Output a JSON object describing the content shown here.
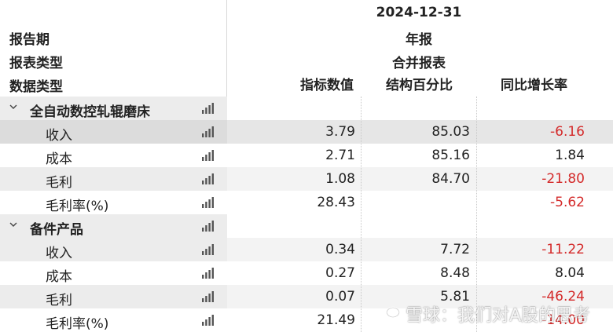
{
  "header": {
    "row_labels": [
      "报告期",
      "报表类型",
      "数据类型"
    ],
    "period": "2024-12-31",
    "period_kind": "年报",
    "statement_type": "合并报表",
    "columns": [
      "指标数值",
      "结构百分比",
      "同比增长率"
    ]
  },
  "groups": [
    {
      "name": "全自动数控轧辊磨床",
      "items": [
        {
          "label": "收入",
          "value": "3.79",
          "structure_pct": "85.03",
          "yoy": "-6.16"
        },
        {
          "label": "成本",
          "value": "2.71",
          "structure_pct": "85.16",
          "yoy": "1.84"
        },
        {
          "label": "毛利",
          "value": "1.08",
          "structure_pct": "84.70",
          "yoy": "-21.80"
        },
        {
          "label": "毛利率(%)",
          "value": "28.43",
          "structure_pct": "",
          "yoy": "-5.62"
        }
      ]
    },
    {
      "name": "备件产品",
      "items": [
        {
          "label": "收入",
          "value": "0.34",
          "structure_pct": "7.72",
          "yoy": "-11.22"
        },
        {
          "label": "成本",
          "value": "0.27",
          "structure_pct": "8.48",
          "yoy": "8.04"
        },
        {
          "label": "毛利",
          "value": "0.07",
          "structure_pct": "5.81",
          "yoy": "-46.24"
        },
        {
          "label": "毛利率(%)",
          "value": "21.49",
          "structure_pct": "",
          "yoy": "-14.00"
        }
      ]
    }
  ],
  "icons": {
    "expand": "chevron-down-icon",
    "chart": "bar-chart-icon"
  },
  "colors": {
    "negative": "#d42a2a",
    "group_bg": "#ececec",
    "stripe_bg": "#f3f3f3",
    "selected_bg": "#e6e6e6"
  },
  "watermark": "雪球：我们对A股的思考"
}
